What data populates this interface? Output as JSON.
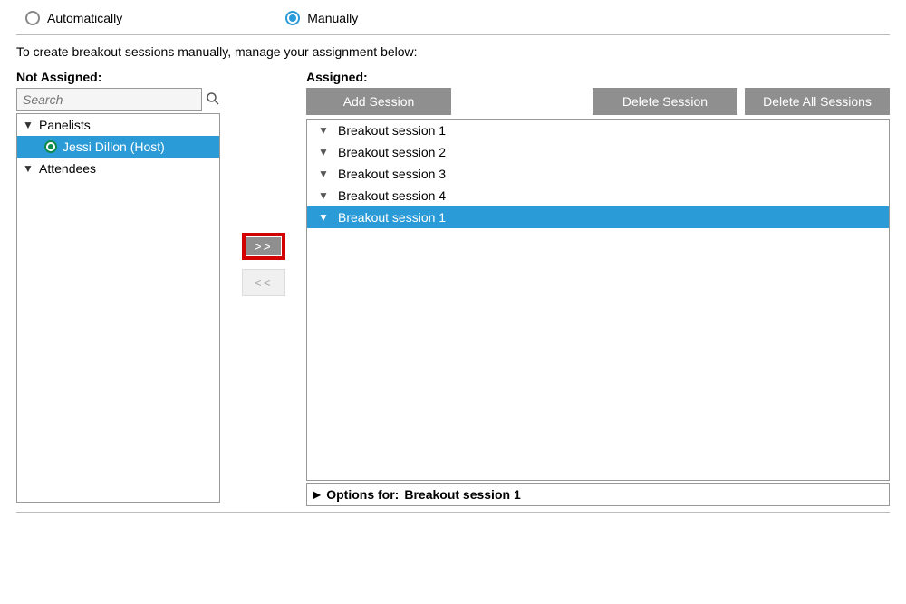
{
  "mode": {
    "auto_label": "Automatically",
    "manual_label": "Manually",
    "selected": "manual"
  },
  "instruction": "To create breakout sessions manually, manage your assignment below:",
  "not_assigned": {
    "title": "Not Assigned:",
    "search_placeholder": "Search",
    "groups": {
      "panelists": {
        "label": "Panelists",
        "expanded": true
      },
      "attendees": {
        "label": "Attendees",
        "expanded": true
      }
    },
    "panelist_items": [
      {
        "label": "Jessi Dillon (Host)",
        "selected": true
      }
    ]
  },
  "assigned": {
    "title": "Assigned:",
    "buttons": {
      "add": "Add Session",
      "delete": "Delete Session",
      "delete_all": "Delete All Sessions"
    },
    "sessions": [
      {
        "label": "Breakout session 1",
        "selected": false
      },
      {
        "label": "Breakout session 2",
        "selected": false
      },
      {
        "label": "Breakout session 3",
        "selected": false
      },
      {
        "label": "Breakout session 4",
        "selected": false
      },
      {
        "label": "Breakout session 1",
        "selected": true
      }
    ],
    "options_prefix": "Options for:",
    "options_target": "Breakout session 1"
  },
  "movers": {
    "assign": ">>",
    "unassign": "<<"
  }
}
